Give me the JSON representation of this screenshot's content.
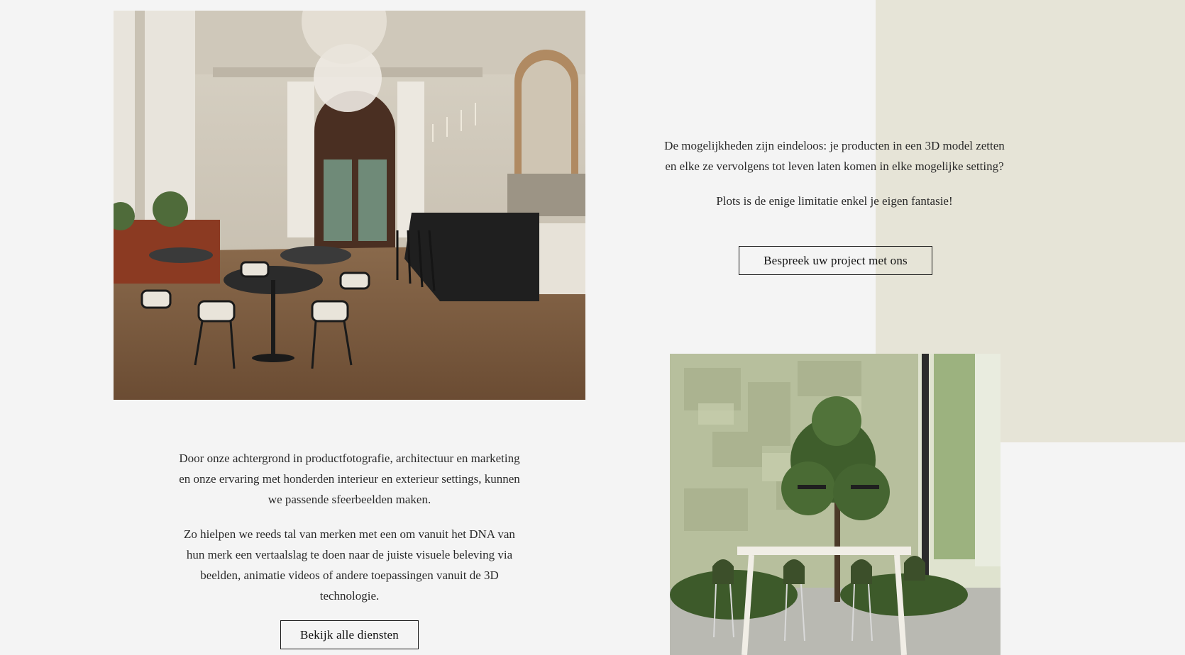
{
  "colors": {
    "page_background": "#f4f4f4",
    "beige_accent": "#e6e4d7",
    "text": "#2a2a2a",
    "button_border": "#1a1a1a"
  },
  "images": {
    "restaurant": "restaurant-interior-render",
    "office": "green-office-interior-render"
  },
  "right_section": {
    "paragraph_1": "De mogelijkheden zijn eindeloos: je producten in een 3D model zetten en elke ze vervolgens tot leven laten komen in elke mogelijke setting?",
    "paragraph_2": "Plots is de enige limitatie enkel je eigen fantasie!",
    "button_label": "Bespreek uw project met ons"
  },
  "left_section": {
    "paragraph_1": "Door onze achtergrond in productfotografie, architectuur en marketing en onze ervaring met honderden interieur en exterieur settings, kunnen we passende sfeerbeelden maken.",
    "paragraph_2": "Zo hielpen we reeds tal van merken met een om vanuit het DNA van hun merk een vertaalslag te doen naar de juiste visuele beleving via beelden, animatie videos of andere toepassingen vanuit de 3D technologie.",
    "button_label": "Bekijk alle diensten"
  }
}
